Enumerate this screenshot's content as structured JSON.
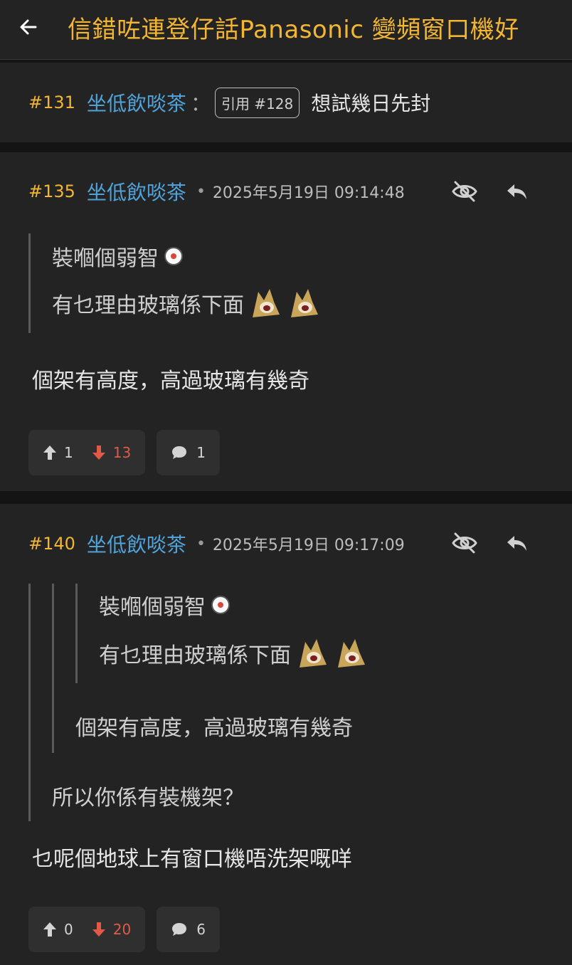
{
  "header": {
    "title": "信錯咗連登仔話Panasonic 變頻窗口機好"
  },
  "quote_preview": {
    "floor": "#131",
    "user": "坐低飲啖茶",
    "colon": "：",
    "ref_label": "引用 #128",
    "text": "想試幾日先封"
  },
  "posts": [
    {
      "floor": "#135",
      "user": "坐低飲啖茶",
      "dot": "•",
      "timestamp": "2025年5月19日 09:14:48",
      "quote_lines": [
        "裝嗰個弱智",
        "有乜理由玻璃係下面"
      ],
      "text": "個架有高度，高過玻璃有幾奇",
      "upvotes": "1",
      "downvotes": "13",
      "comments": "1"
    },
    {
      "floor": "#140",
      "user": "坐低飲啖茶",
      "dot": "•",
      "timestamp": "2025年5月19日 09:17:09",
      "nested_quote_lines": [
        "裝嗰個弱智",
        "有乜理由玻璃係下面"
      ],
      "quote_line": "個架有高度，高過玻璃有幾奇",
      "outer_quote_line": "所以你係有裝機架？",
      "text": "乜呢個地球上有窗口機唔洗架嘅咩",
      "upvotes": "0",
      "downvotes": "20",
      "comments": "6"
    }
  ],
  "icons": {
    "back": "arrow-left-icon",
    "eye": "eye-off-icon",
    "reply": "reply-icon",
    "up": "arrow-up-icon",
    "down": "arrow-down-icon",
    "comment": "comment-icon"
  },
  "colors": {
    "accent": "#f2b632",
    "username": "#4fa3d9",
    "downvote": "#e05a47",
    "background": "#232323"
  }
}
